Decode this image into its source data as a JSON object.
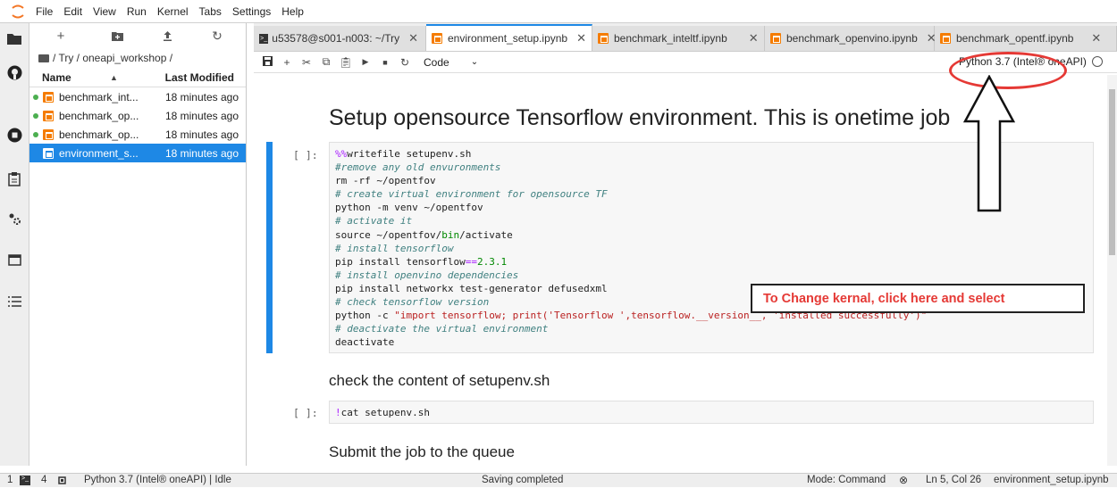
{
  "menubar": {
    "items": [
      "File",
      "Edit",
      "View",
      "Run",
      "Kernel",
      "Tabs",
      "Settings",
      "Help"
    ]
  },
  "leftbar": {
    "icons": [
      "folder-icon",
      "github-icon",
      "running-icon",
      "commands-icon",
      "extensions-icon",
      "tabs-icon",
      "toc-icon"
    ]
  },
  "filebrowser": {
    "toolbar": [
      "new-launcher-icon",
      "new-folder-icon",
      "upload-icon",
      "refresh-icon"
    ],
    "breadcrumb": "/ Try / oneapi_workshop /",
    "header": {
      "name": "Name",
      "modified": "Last Modified"
    },
    "files": [
      {
        "name": "benchmark_int...",
        "modified": "18 minutes ago",
        "selected": false
      },
      {
        "name": "benchmark_op...",
        "modified": "18 minutes ago",
        "selected": false
      },
      {
        "name": "benchmark_op...",
        "modified": "18 minutes ago",
        "selected": false
      },
      {
        "name": "environment_s...",
        "modified": "18 minutes ago",
        "selected": true
      }
    ]
  },
  "tabs": [
    {
      "label": "u53578@s001-n003: ~/Try",
      "kind": "terminal",
      "active": false
    },
    {
      "label": "environment_setup.ipynb",
      "kind": "notebook",
      "active": true
    },
    {
      "label": "benchmark_inteltf.ipynb",
      "kind": "notebook",
      "active": false
    },
    {
      "label": "benchmark_openvino.ipynb",
      "kind": "notebook",
      "active": false
    },
    {
      "label": "benchmark_opentf.ipynb",
      "kind": "notebook",
      "active": false
    }
  ],
  "nbtoolbar": {
    "cell_type": "Code",
    "kernel": "Python 3.7 (Intel® oneAPI)"
  },
  "notebook": {
    "heading": "Setup opensource Tensorflow environment. This is onetime job",
    "prompt1": "[ ]:",
    "heading2": "check the content of setupenv.sh",
    "prompt2": "[ ]:",
    "heading3": "Submit the job to the queue"
  },
  "annotation": {
    "text": "To Change kernal, click here and select"
  },
  "statusbar": {
    "count1": "1",
    "count2": "4",
    "kernel_status": "Python 3.7 (Intel® oneAPI) | Idle",
    "save_status": "Saving completed",
    "mode": "Mode: Command",
    "position": "Ln 5, Col 26",
    "filename": "environment_setup.ipynb"
  },
  "colors": {
    "accent": "#1e88e5",
    "annotation_red": "#e53935",
    "notebook_orange": "#f57c00"
  }
}
